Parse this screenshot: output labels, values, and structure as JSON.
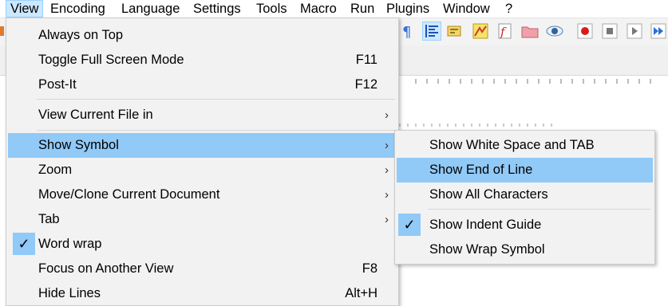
{
  "menubar": {
    "items": [
      "View",
      "Encoding",
      "Language",
      "Settings",
      "Tools",
      "Macro",
      "Run",
      "Plugins",
      "Window",
      "?"
    ]
  },
  "toolbar": {
    "icons": [
      "paragraph-icon",
      "indent-guide-icon",
      "wrap-icon",
      "document-map-icon",
      "function-list-icon",
      "folder-icon",
      "monitor-icon",
      "record-icon",
      "stop-icon",
      "play-icon",
      "play-multiple-icon"
    ]
  },
  "view_menu": {
    "items": [
      {
        "label": "Always on Top",
        "shortcut": "",
        "submenu": false
      },
      {
        "label": "Toggle Full Screen Mode",
        "shortcut": "F11",
        "submenu": false
      },
      {
        "label": "Post-It",
        "shortcut": "F12",
        "submenu": false
      },
      {
        "label": "View Current File in",
        "shortcut": "",
        "submenu": true
      },
      {
        "label": "Show Symbol",
        "shortcut": "",
        "submenu": true,
        "highlighted": true
      },
      {
        "label": "Zoom",
        "shortcut": "",
        "submenu": true
      },
      {
        "label": "Move/Clone Current Document",
        "shortcut": "",
        "submenu": true
      },
      {
        "label": "Tab",
        "shortcut": "",
        "submenu": true
      },
      {
        "label": "Word wrap",
        "shortcut": "",
        "submenu": false,
        "checked": true
      },
      {
        "label": "Focus on Another View",
        "shortcut": "F8",
        "submenu": false
      },
      {
        "label": "Hide Lines",
        "shortcut": "Alt+H",
        "submenu": false
      }
    ],
    "arrow": "›"
  },
  "symbol_menu": {
    "items": [
      {
        "label": "Show White Space and TAB",
        "checked": false
      },
      {
        "label": "Show End of Line",
        "checked": false,
        "highlighted": true
      },
      {
        "label": "Show All Characters",
        "checked": false
      },
      {
        "label": "Show Indent Guide",
        "checked": true
      },
      {
        "label": "Show Wrap Symbol",
        "checked": false
      }
    ],
    "check_glyph": "✓"
  },
  "colors": {
    "highlight": "#91c9f7",
    "menu_bg": "#f2f2f2",
    "active_menubar": "#cce8ff"
  }
}
